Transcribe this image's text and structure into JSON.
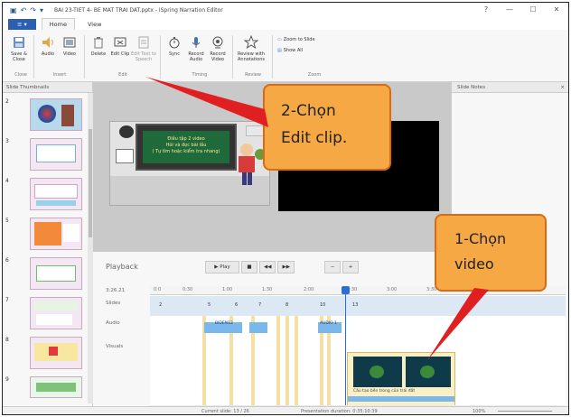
{
  "window": {
    "title": "BAI 23-TIET 4- BE MAT TRAI DAT.pptx - iSpring Narration Editor",
    "controls": [
      "?",
      "—",
      "☐",
      "✕"
    ]
  },
  "tabs": {
    "file": "≡ ▾",
    "home": "Home",
    "view": "View"
  },
  "ribbon": {
    "buttons": {
      "save_close": "Save & Close",
      "audio": "Audio",
      "video": "Video",
      "delete": "Delete",
      "edit_clip": "Edit Clip",
      "edit_text": "Edit Text to Speech",
      "sync": "Sync",
      "record_audio": "Record Audio",
      "record_video": "Record Video",
      "review": "Review with Annotations"
    },
    "small_buttons": {
      "zoom_to_slide": "Zoom to Slide",
      "show_all": "Show All"
    },
    "groups": {
      "close": "Close",
      "insert": "Insert",
      "edit": "Edit",
      "timing": "Timing",
      "review": "Review",
      "zoom": "Zoom"
    }
  },
  "slide_panel": {
    "header": "Slide Thumbnails",
    "thumbnails": [
      "2",
      "3",
      "4",
      "5",
      "6",
      "7",
      "8",
      "9"
    ]
  },
  "notes": {
    "header": "Slide Notes",
    "close": "×"
  },
  "slide": {
    "text_line1": "Điều tập 2 video",
    "text_line2": "Hỏi và đọc bài lầu",
    "text_line3": "( Tự tìm hoặc kiểm tra nhang)"
  },
  "timeline": {
    "playback_label": "Playback",
    "play_button": "▶ Play",
    "stop_button": "■",
    "prev_button": "◀◀",
    "next_button": "▶▶",
    "zoom_out": "−",
    "zoom_in": "+",
    "time_readout": "3:26.21",
    "track_labels": {
      "slides": "Slides",
      "audio": "Audio",
      "visuals": "Visuals"
    },
    "ruler_ticks": [
      "0:0",
      "0:30",
      "1:00",
      "1:30",
      "2:00",
      "2:30",
      "3:00",
      "3:30"
    ],
    "slide_markers": [
      "2",
      "5",
      "6",
      "7",
      "8",
      "10",
      "13"
    ],
    "audio_clips": [
      "BIDEN12",
      "AUDIO 1"
    ],
    "video_caption": "Cấu tạo bên trong của trái đất"
  },
  "status": {
    "current_slide": "Current slide: 13 / 26",
    "duration": "Presentation duration: 0:35:10:39",
    "zoom": "100%"
  },
  "annotations": {
    "callout_edit_line1": "2-Chọn",
    "callout_edit_line2": "Edit clip.",
    "callout_video_line1": "1-Chọn",
    "callout_video_line2": "video"
  },
  "colors": {
    "accent": "#2b5fb4",
    "callout_fill": "#f5a843",
    "callout_border": "#d96a16",
    "arrow": "#e02020",
    "playhead": "#2a6fd6"
  }
}
